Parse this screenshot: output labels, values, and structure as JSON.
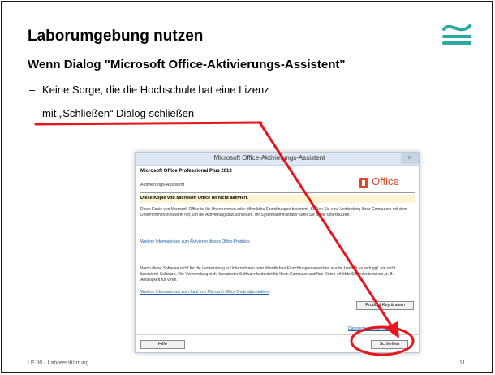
{
  "slide": {
    "title": "Laborumgebung nutzen",
    "subtitle": "Wenn Dialog \"Microsoft Office-Aktivierungs-Assistent\"",
    "bullets": [
      "Keine Sorge, die die Hochschule hat eine Lizenz",
      "mit „Schließen“ Dialog schließen"
    ],
    "bullet_marker": "–",
    "footer_left": "LE 00 - Laboreinführung",
    "page_number": "11",
    "logo_icon": "wave-logo-icon"
  },
  "dialog": {
    "title": "Microsoft Office-Aktivierungs-Assistent",
    "close_glyph": "✕",
    "product": "Microsoft Office Professional Plus 2013",
    "subtitle": "Aktivierungs-Assistent",
    "office_brand": "Office",
    "warning": "Diese Kopie von Microsoft Office ist nicht aktiviert.",
    "paragraph1": "Diese Kopie von Microsoft Office ist für Unternehmen oder öffentliche Einrichtungen bestimmt. Stellen Sie eine Verbindung Ihres Computers mit dem Unternehmensnetzwerk her, um die Aktivierung abzuschließen. Ihr Systemadministrator kann Sie dabei unterstützen.",
    "link1": "Weitere Informationen zum Aktivieren dieses Office-Produkts",
    "paragraph2": "Wenn diese Software nicht für die Verwendung in Unternehmen oder öffentlichen Einrichtungen erworben wurde, handelt es sich ggf. um nicht lizenzierte Software. Die Verwendung nicht lizenzierter Software bedeutet für Ihren Computer und Ihre Daten erhöhte Sicherheitsrisiken, z. B. Anfälligkeit für Viren.",
    "link2": "Weitere Informationen zum Kauf von Microsoft Office-Originalprodukten",
    "product_key_button": "Product Key ändern",
    "privacy_link": "Datenschutzbestimmungen",
    "help_button": "Hilfe",
    "close_button": "Schließen"
  },
  "colors": {
    "annotation": "#e8141c",
    "office_brand": "#d24625",
    "link": "#1f5fa8"
  }
}
